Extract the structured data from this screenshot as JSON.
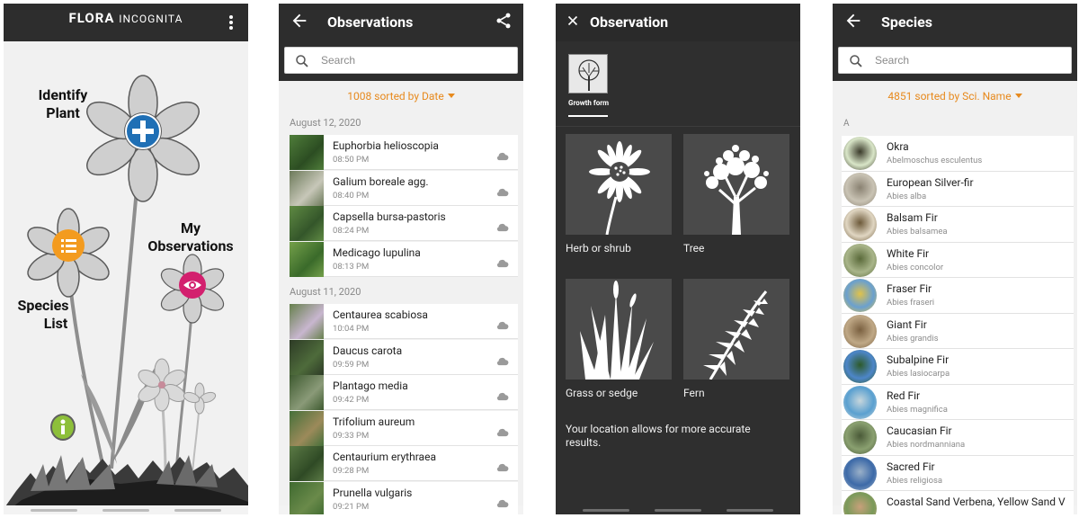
{
  "home": {
    "logo_main": "FLORA",
    "logo_sub": "INCOGNITA",
    "identify_label_1": "Identify",
    "identify_label_2": "Plant",
    "observations_label_1": "My",
    "observations_label_2": "Observations",
    "species_label_1": "Species",
    "species_label_2": "List"
  },
  "observations": {
    "title": "Observations",
    "search_placeholder": "Search",
    "sort_text": "1008 sorted by Date",
    "groups": [
      {
        "date": "August 12, 2020",
        "items": [
          {
            "name": "Euphorbia helioscopia",
            "time": "08:50 PM"
          },
          {
            "name": "Galium boreale agg.",
            "time": "08:40 PM"
          },
          {
            "name": "Capsella bursa-pastoris",
            "time": "08:24 PM"
          },
          {
            "name": "Medicago lupulina",
            "time": "08:13 PM"
          }
        ]
      },
      {
        "date": "August 11, 2020",
        "items": [
          {
            "name": "Centaurea scabiosa",
            "time": "10:04 PM"
          },
          {
            "name": "Daucus carota",
            "time": "09:59 PM"
          },
          {
            "name": "Plantago media",
            "time": "09:42 PM"
          },
          {
            "name": "Trifolium aureum",
            "time": "09:33 PM"
          },
          {
            "name": "Centaurium erythraea",
            "time": "09:28 PM"
          },
          {
            "name": "Prunella vulgaris",
            "time": "09:21 PM"
          }
        ]
      }
    ]
  },
  "observation": {
    "title": "Observation",
    "tab_label": "Growth form",
    "options": [
      "Herb or shrub",
      "Tree",
      "Grass or sedge",
      "Fern"
    ],
    "location_note": "Your location allows for more accurate results."
  },
  "species": {
    "title": "Species",
    "search_placeholder": "Search",
    "sort_text": "4851 sorted by Sci. Name",
    "section": "A",
    "items": [
      {
        "common": "Okra",
        "sci": "Abelmoschus esculentus"
      },
      {
        "common": "European Silver-fir",
        "sci": "Abies alba"
      },
      {
        "common": "Balsam Fir",
        "sci": "Abies balsamea"
      },
      {
        "common": "White Fir",
        "sci": "Abies concolor"
      },
      {
        "common": "Fraser Fir",
        "sci": "Abies fraseri"
      },
      {
        "common": "Giant Fir",
        "sci": "Abies grandis"
      },
      {
        "common": "Subalpine Fir",
        "sci": "Abies lasiocarpa"
      },
      {
        "common": "Red Fir",
        "sci": "Abies magnifica"
      },
      {
        "common": "Caucasian Fir",
        "sci": "Abies nordmanniana"
      },
      {
        "common": "Sacred Fir",
        "sci": "Abies religiosa"
      },
      {
        "common": "Coastal Sand Verbena, Yellow Sand V",
        "sci": ""
      }
    ]
  },
  "colors": {
    "appbar": "#2d2d2d",
    "accent": "#e78a1e",
    "identify_blue": "#1f6fb5",
    "species_orange": "#f39b1f",
    "observations_pink": "#d3206e",
    "info_green": "#8dbf3a"
  }
}
